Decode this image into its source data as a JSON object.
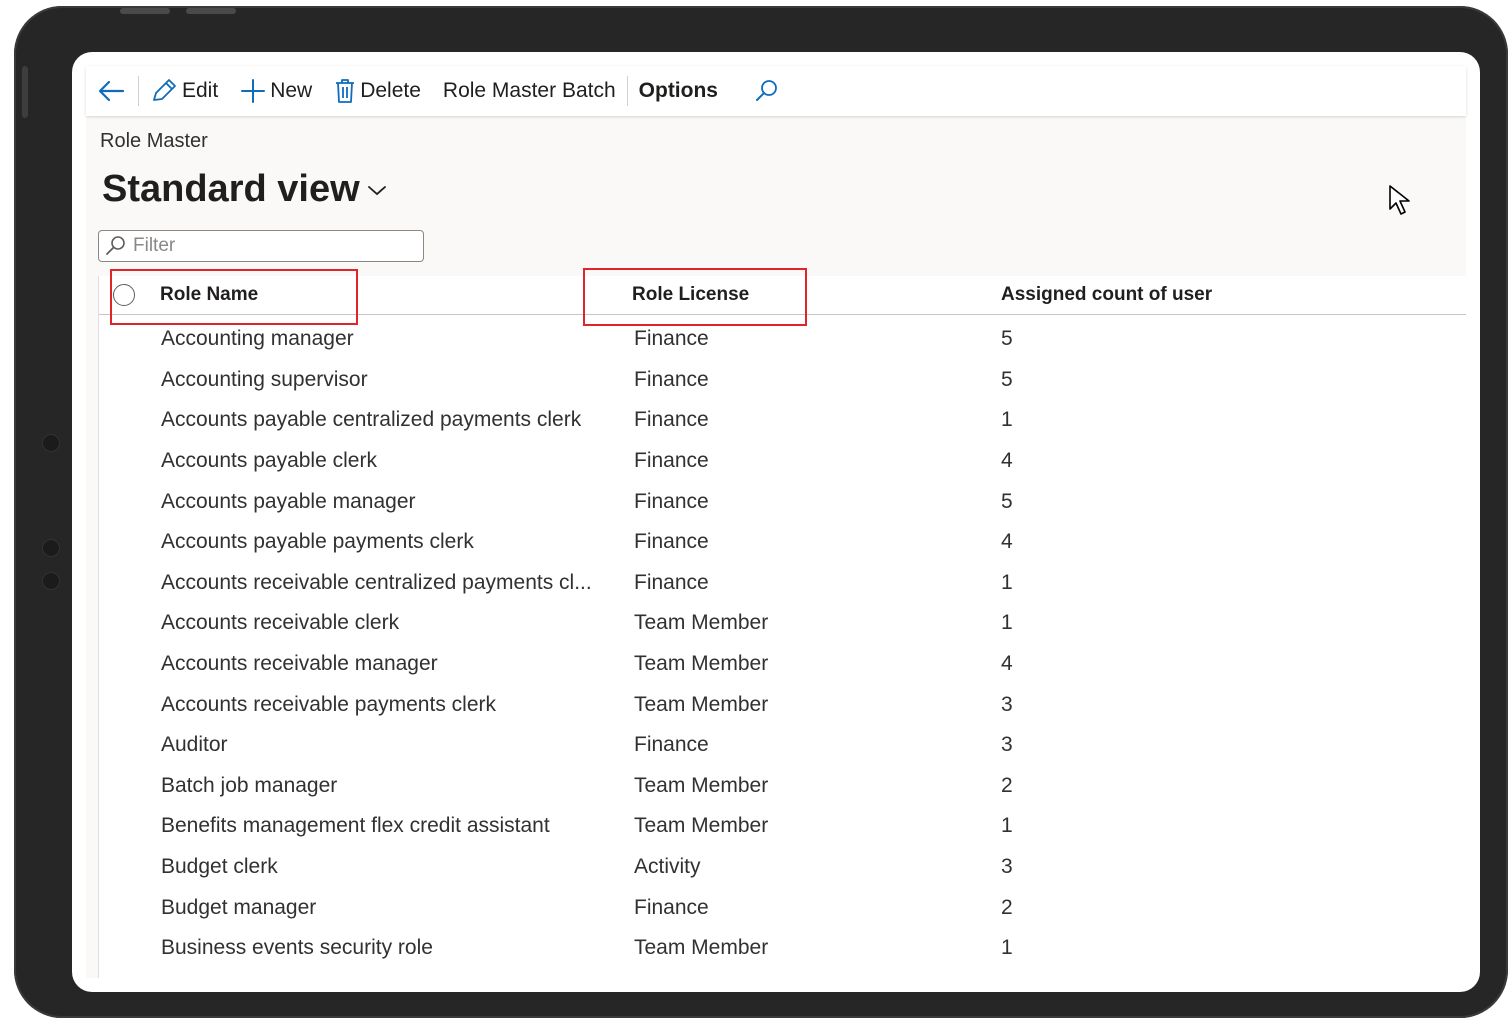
{
  "toolbar": {
    "back_label": "",
    "edit_label": "Edit",
    "new_label": "New",
    "delete_label": "Delete",
    "batch_label": "Role Master Batch",
    "options_label": "Options"
  },
  "page": {
    "caption": "Role Master",
    "view_title": "Standard view"
  },
  "filter": {
    "placeholder": "Filter",
    "value": ""
  },
  "grid": {
    "columns": [
      "Role Name",
      "Role License",
      "Assigned count of user"
    ],
    "rows": [
      {
        "name": "Accounting manager",
        "license": "Finance",
        "count": "5"
      },
      {
        "name": "Accounting supervisor",
        "license": "Finance",
        "count": "5"
      },
      {
        "name": "Accounts payable centralized payments clerk",
        "license": "Finance",
        "count": "1"
      },
      {
        "name": "Accounts payable clerk",
        "license": "Finance",
        "count": "4"
      },
      {
        "name": "Accounts payable manager",
        "license": "Finance",
        "count": "5"
      },
      {
        "name": "Accounts payable payments clerk",
        "license": "Finance",
        "count": "4"
      },
      {
        "name": "Accounts receivable centralized payments cl...",
        "license": "Finance",
        "count": "1"
      },
      {
        "name": "Accounts receivable clerk",
        "license": "Team Member",
        "count": "1"
      },
      {
        "name": "Accounts receivable manager",
        "license": "Team Member",
        "count": "4"
      },
      {
        "name": "Accounts receivable payments clerk",
        "license": "Team Member",
        "count": "3"
      },
      {
        "name": "Auditor",
        "license": "Finance",
        "count": "3"
      },
      {
        "name": "Batch job manager",
        "license": "Team Member",
        "count": "2"
      },
      {
        "name": "Benefits management flex credit assistant",
        "license": "Team Member",
        "count": "1"
      },
      {
        "name": "Budget clerk",
        "license": "Activity",
        "count": "3"
      },
      {
        "name": "Budget manager",
        "license": "Finance",
        "count": "2"
      },
      {
        "name": "Business events security role",
        "license": "Team Member",
        "count": "1"
      }
    ]
  },
  "colors": {
    "accent": "#0f6cbd",
    "highlight": "#e0242a",
    "frame": "#262626"
  },
  "icons": {
    "back": "arrow-left-icon",
    "edit": "pencil-icon",
    "new": "plus-icon",
    "delete": "trash-icon",
    "search": "search-icon",
    "filter": "search-icon",
    "view": "chevron-down-icon",
    "select": "radio-circle-icon",
    "pointer": "mouse-cursor-icon"
  }
}
